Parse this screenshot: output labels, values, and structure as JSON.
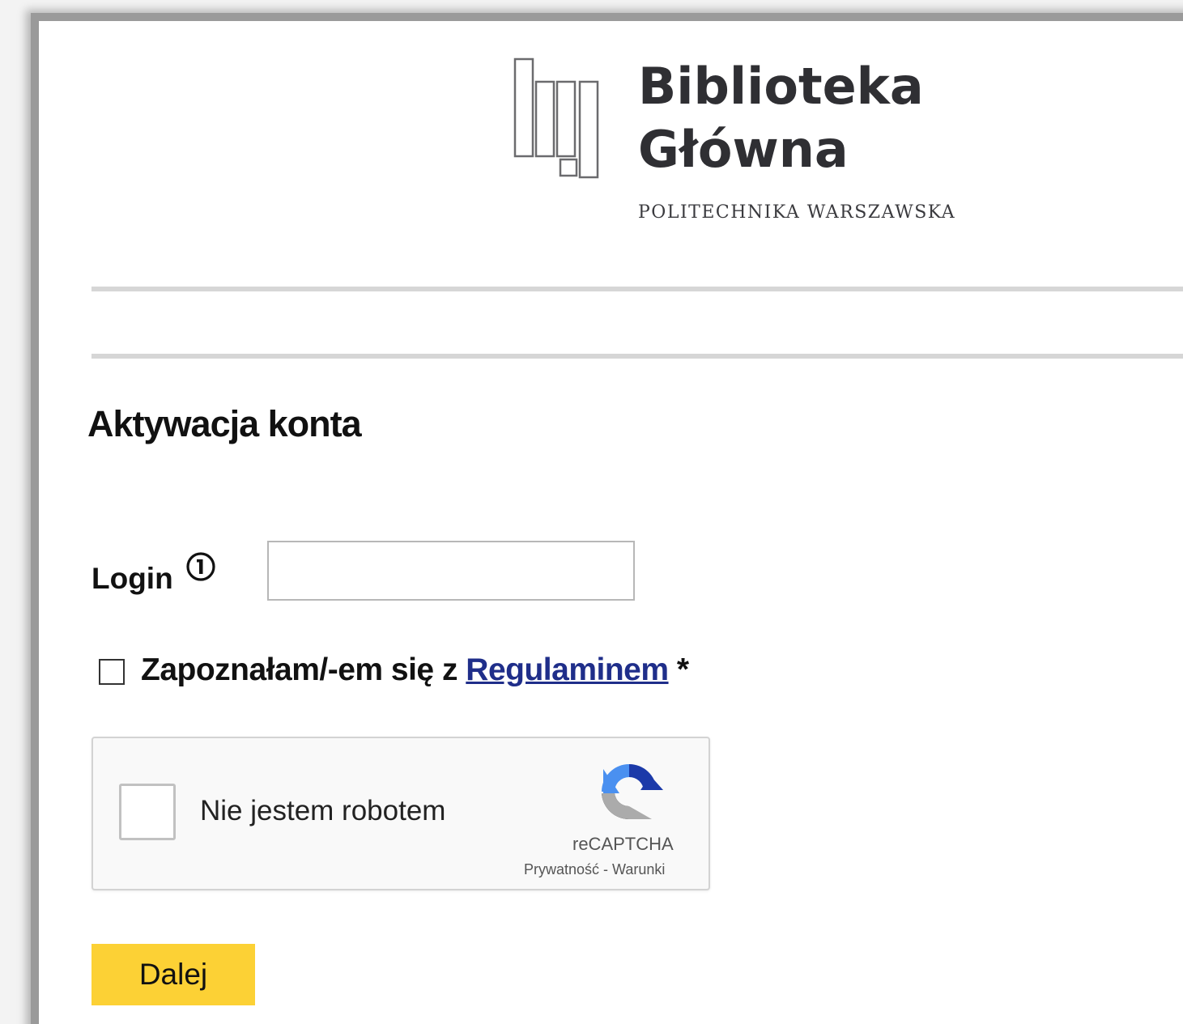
{
  "header": {
    "logo_line1": "Biblioteka",
    "logo_line2": "Główna",
    "logo_subtitle": "POLITECHNIKA WARSZAWSKA",
    "logo_icon": "library-books-logo-icon"
  },
  "main": {
    "title": "Aktywacja konta",
    "login": {
      "label": "Login",
      "info_icon": "info-icon",
      "value": "",
      "placeholder": ""
    },
    "terms": {
      "prefix": "Zapoznałam/-em się z ",
      "link_text": "Regulaminem",
      "suffix": " *",
      "checked": false
    },
    "recaptcha": {
      "label": "Nie jestem robotem",
      "brand": "reCAPTCHA",
      "links": "Prywatność - Warunki",
      "icon": "recaptcha-logo-icon"
    },
    "next_button": "Dalej"
  },
  "colors": {
    "button_bg": "#fcd135",
    "link": "#1f2e8a",
    "rule": "#d6d6d6"
  }
}
